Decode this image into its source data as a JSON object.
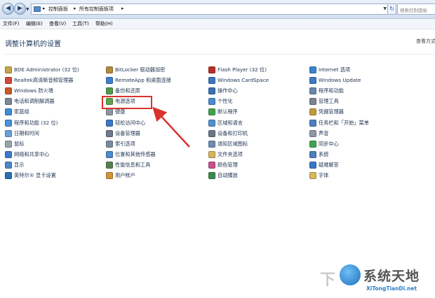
{
  "address_bar": {
    "crumbs": [
      "控制面板",
      "所有控制面板项"
    ],
    "search_placeholder": "搜索控制面板"
  },
  "menu": [
    "文件(F)",
    "编辑(E)",
    "查看(V)",
    "工具(T)",
    "帮助(H)"
  ],
  "page_title": "调整计算机的设置",
  "view_by": "查看方式",
  "columns": [
    [
      {
        "label": "BDE Administrator (32 位)",
        "icon": "database-icon",
        "color": "#c9a34a"
      },
      {
        "label": "Realtek高清晰音频管理器",
        "icon": "speaker-icon",
        "color": "#d24a3a"
      },
      {
        "label": "Windows 防火墙",
        "icon": "firewall-icon",
        "color": "#c85a2a"
      },
      {
        "label": "电话和调制解调器",
        "icon": "phone-icon",
        "color": "#7a8795"
      },
      {
        "label": "家庭组",
        "icon": "homegroup-icon",
        "color": "#3c8fd6"
      },
      {
        "label": "程序和功能 (32 位)",
        "icon": "programs-icon",
        "color": "#4a90d9"
      },
      {
        "label": "日期和时间",
        "icon": "clock-icon",
        "color": "#6aa0d8"
      },
      {
        "label": "鼠标",
        "icon": "mouse-icon",
        "color": "#9aa4ad"
      },
      {
        "label": "网络和共享中心",
        "icon": "network-icon",
        "color": "#3b7bc9"
      },
      {
        "label": "显示",
        "icon": "display-icon",
        "color": "#4d86c8"
      },
      {
        "label": "英特尔® 显卡设置",
        "icon": "intel-graphics-icon",
        "color": "#2c6db5"
      }
    ],
    [
      {
        "label": "BitLocker 驱动器加密",
        "icon": "bitlocker-icon",
        "color": "#b08a3a"
      },
      {
        "label": "RemoteApp 和桌面连接",
        "icon": "remoteapp-icon",
        "color": "#3f7fcf"
      },
      {
        "label": "备份和还原",
        "icon": "backup-icon",
        "color": "#4f9a4a"
      },
      {
        "label": "电源选项",
        "icon": "power-options-icon",
        "color": "#5da34e"
      },
      {
        "label": "键盘",
        "icon": "keyboard-icon",
        "color": "#8c96a0"
      },
      {
        "label": "轻松访问中心",
        "icon": "accessibility-icon",
        "color": "#3a78c8"
      },
      {
        "label": "设备管理器",
        "icon": "device-manager-icon",
        "color": "#6d7a88"
      },
      {
        "label": "索引选项",
        "icon": "index-icon",
        "color": "#7c8aa0"
      },
      {
        "label": "位置和其他传感器",
        "icon": "sensor-icon",
        "color": "#4d8ac9"
      },
      {
        "label": "性能信息和工具",
        "icon": "performance-icon",
        "color": "#59804f"
      },
      {
        "label": "用户帐户",
        "icon": "user-accounts-icon",
        "color": "#d2913a"
      }
    ],
    [
      {
        "label": "Flash Player (32 位)",
        "icon": "flash-icon",
        "color": "#b92f27"
      },
      {
        "label": "Windows CardSpace",
        "icon": "cardspace-icon",
        "color": "#3d75c0"
      },
      {
        "label": "操作中心",
        "icon": "action-center-icon",
        "color": "#3b6fb5"
      },
      {
        "label": "个性化",
        "icon": "personalize-icon",
        "color": "#4b8ad0"
      },
      {
        "label": "默认程序",
        "icon": "default-programs-icon",
        "color": "#3fa34d"
      },
      {
        "label": "区域和语言",
        "icon": "region-icon",
        "color": "#4f91cf"
      },
      {
        "label": "设备和打印机",
        "icon": "printer-icon",
        "color": "#6b7785"
      },
      {
        "label": "通知区域图标",
        "icon": "notification-icon",
        "color": "#6d8db0"
      },
      {
        "label": "文件夹选项",
        "icon": "folder-icon",
        "color": "#d6b45a"
      },
      {
        "label": "颜色管理",
        "icon": "color-icon",
        "color": "#c94f8c"
      },
      {
        "label": "自动播放",
        "icon": "autoplay-icon",
        "color": "#3c8b4e"
      }
    ],
    [
      {
        "label": "Internet 选项",
        "icon": "internet-icon",
        "color": "#3a84cd"
      },
      {
        "label": "Windows Update",
        "icon": "windows-update-icon",
        "color": "#3f79c4"
      },
      {
        "label": "程序和功能",
        "icon": "programs-features-icon",
        "color": "#6b87a8"
      },
      {
        "label": "管理工具",
        "icon": "admin-tools-icon",
        "color": "#7a8591"
      },
      {
        "label": "凭据管理器",
        "icon": "credential-icon",
        "color": "#c69a3f"
      },
      {
        "label": "任务栏和「开始」菜单",
        "icon": "taskbar-icon",
        "color": "#4a7fc2"
      },
      {
        "label": "声音",
        "icon": "sound-icon",
        "color": "#8d98a3"
      },
      {
        "label": "同步中心",
        "icon": "sync-icon",
        "color": "#3fa353"
      },
      {
        "label": "系统",
        "icon": "system-icon",
        "color": "#4d7fbe"
      },
      {
        "label": "疑难解答",
        "icon": "troubleshoot-icon",
        "color": "#3a76c5"
      },
      {
        "label": "字体",
        "icon": "fonts-icon",
        "color": "#d8b85a"
      }
    ]
  ],
  "watermark": {
    "text": "系统天地",
    "url": "XiTongTianDi.net",
    "ghost": "下"
  }
}
